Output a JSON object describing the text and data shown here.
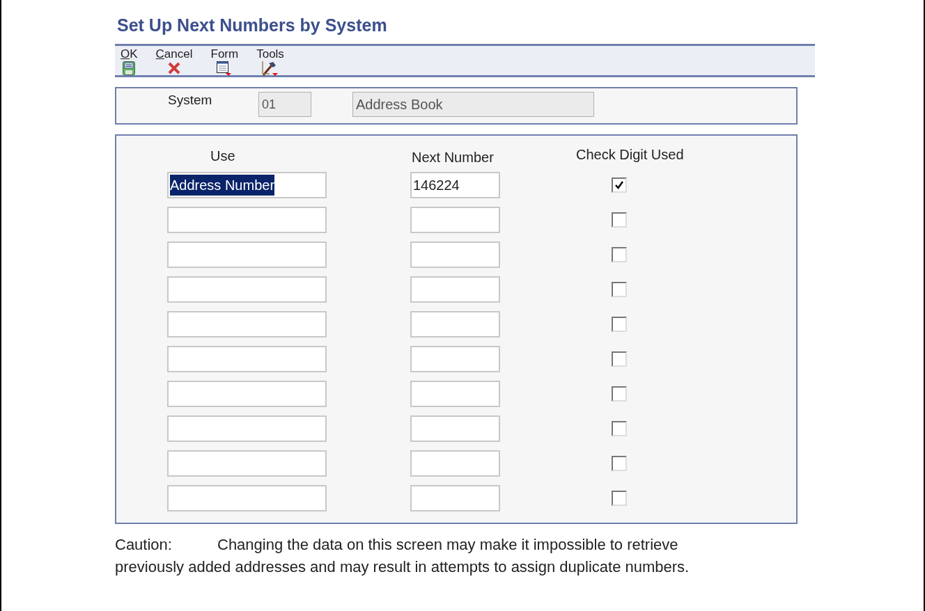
{
  "window": {
    "title": "Set Up Next Numbers by System"
  },
  "toolbar": [
    {
      "label": "OK",
      "underlined": true,
      "kind": "save"
    },
    {
      "label": "Cancel",
      "underlined": true,
      "kind": "cancel"
    },
    {
      "label": "Form",
      "underlined": false,
      "kind": "form"
    },
    {
      "label": "Tools",
      "underlined": false,
      "kind": "tools"
    }
  ],
  "system": {
    "label": "System",
    "code": "01",
    "name": "Address Book"
  },
  "columns": [
    "Use",
    "Next Number",
    "Check Digit Used"
  ],
  "rows": [
    {
      "use": "Address Number",
      "use_highlighted": true,
      "next_number": "146224",
      "check_digit_used": true
    },
    {
      "check_digit_used": false
    },
    {
      "check_digit_used": false
    },
    {
      "check_digit_used": false
    },
    {
      "check_digit_used": false
    },
    {
      "check_digit_used": false
    },
    {
      "check_digit_used": false
    },
    {
      "check_digit_used": false
    },
    {
      "check_digit_used": false
    },
    {
      "check_digit_used": false
    }
  ],
  "caution": {
    "label": "Caution:",
    "text": "Changing the data on this screen may make it impossible to retrieve previously added addresses and may result in attempts to assign duplicate numbers."
  }
}
